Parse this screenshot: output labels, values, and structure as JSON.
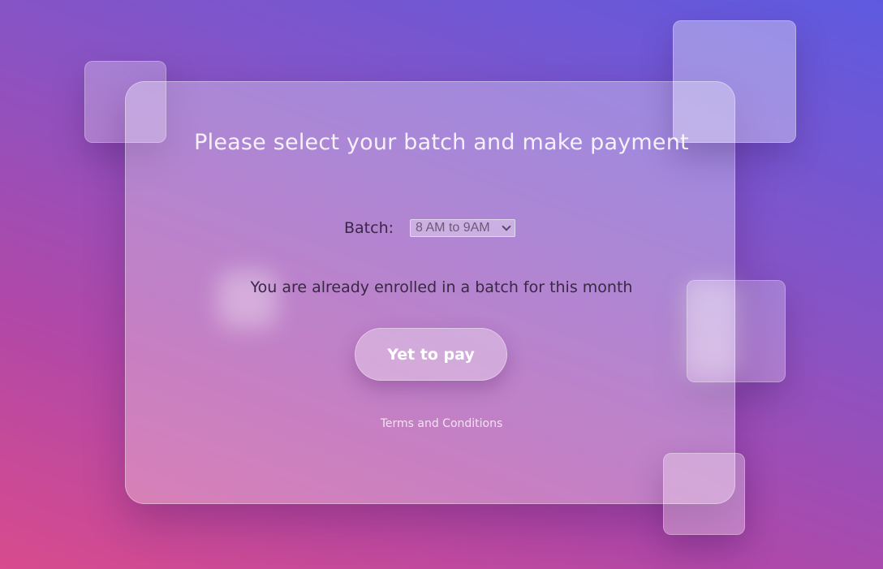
{
  "form": {
    "title": "Please select your batch and make payment",
    "batch_label": "Batch:",
    "batch_selected": "8 AM to 9AM",
    "status_message": "You are already enrolled in a batch for this month",
    "pay_button_label": "Yet to pay",
    "terms_link": "Terms and Conditions"
  },
  "icons": {
    "select_arrow": "chevron-down-icon"
  },
  "colors": {
    "gradient_start": "#d84b8d",
    "gradient_end": "#5e5ae0",
    "text_dark": "#3a2746"
  }
}
